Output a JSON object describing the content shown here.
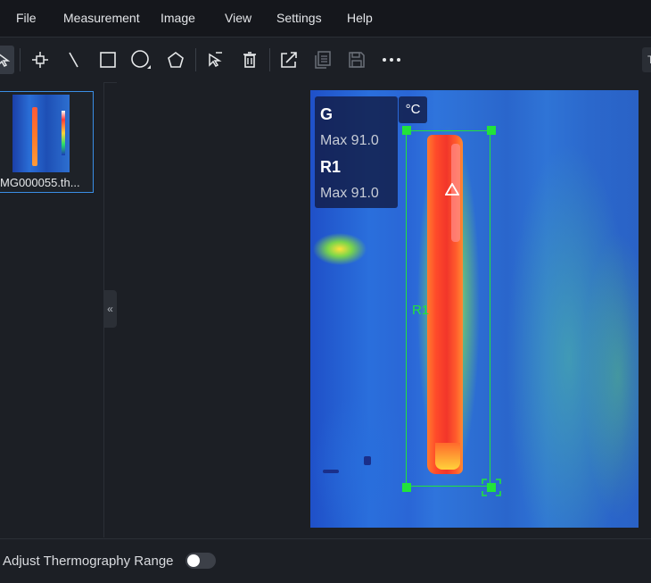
{
  "menu": {
    "items": [
      {
        "id": "file",
        "label": "File"
      },
      {
        "id": "measurement",
        "label": "Measurement"
      },
      {
        "id": "image",
        "label": "Image"
      },
      {
        "id": "view",
        "label": "View"
      },
      {
        "id": "settings",
        "label": "Settings"
      },
      {
        "id": "help",
        "label": "Help"
      }
    ]
  },
  "toolbar": {
    "tools": [
      {
        "id": "select-tool",
        "icon": "cursor-icon"
      },
      {
        "id": "point-tool",
        "icon": "crosshair-point-icon"
      },
      {
        "id": "line-tool",
        "icon": "line-icon"
      },
      {
        "id": "rectangle-tool",
        "icon": "rectangle-icon"
      },
      {
        "id": "ellipse-tool",
        "icon": "ellipse-icon"
      },
      {
        "id": "polygon-tool",
        "icon": "polygon-icon"
      },
      {
        "id": "clear-selection",
        "icon": "cursor-clear-icon"
      },
      {
        "id": "delete",
        "icon": "trash-icon"
      },
      {
        "id": "export",
        "icon": "export-icon"
      },
      {
        "id": "copy",
        "icon": "copy-icon"
      },
      {
        "id": "save",
        "icon": "save-icon"
      },
      {
        "id": "more",
        "icon": "more-icon"
      }
    ],
    "right_button_label": "T"
  },
  "thumbnail": {
    "filename": "MG000055.th..."
  },
  "collapse": {
    "glyph": "«"
  },
  "measurement_overlay": {
    "global_label": "G",
    "global_value": "Max 91.0",
    "roi_label": "R1",
    "roi_value": "Max 91.0",
    "unit": "°C"
  },
  "roi": {
    "name": "R1",
    "color": "#22e33a",
    "max_marker_icon": "triangle-max-icon"
  },
  "bottom": {
    "adjust_label": "Adjust Thermography Range",
    "toggle_on": false
  },
  "colors": {
    "accent": "#3a8ee6",
    "roi_green": "#22e33a",
    "background": "#1c1f25"
  }
}
